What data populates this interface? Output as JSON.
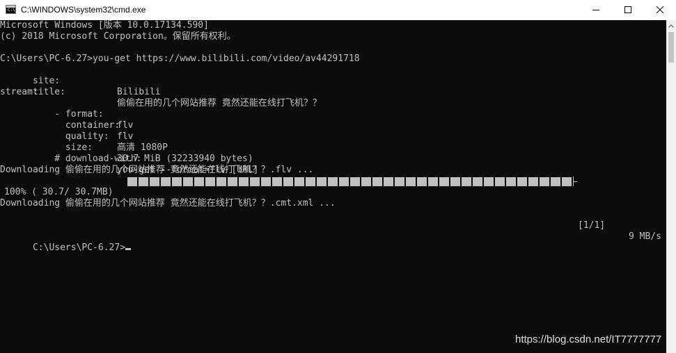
{
  "window": {
    "title": "C:\\WINDOWS\\system32\\cmd.exe",
    "icon": "cmd-icon",
    "icon_glyph": "C:\\_"
  },
  "controls": {
    "minimize_icon": "minimize-icon",
    "maximize_icon": "maximize-icon",
    "close_icon": "close-icon"
  },
  "console": {
    "header1": "Microsoft Windows [版本 10.0.17134.590]",
    "header2": "(c) 2018 Microsoft Corporation。保留所有权利。",
    "command_line": "C:\\Users\\PC-6.27>you-get https://www.bilibili.com/video/av44291718",
    "site_label": "site:",
    "site_value": "Bilibili",
    "title_label": "title:",
    "title_value": "偷偷在用的几个网站推荐 竟然还能在线打飞机？？",
    "stream_label": "stream:",
    "format_label": "    - format:",
    "format_value": "flv",
    "container_label": "      container:",
    "container_value": "flv",
    "quality_label": "      quality:",
    "quality_value": "高清 1080P",
    "size_label": "      size:",
    "size_value": "30.7 MiB (32233940 bytes)",
    "download_with_label": "    # download-with:",
    "download_with_value": "you-get --format=flv [URL]",
    "downloading_flv": "Downloading 偷偷在用的几个网站推荐 竟然还能在线打飞机？？.flv ...",
    "progress_percent_text": "100% ( 30.7/ 30.7MB)",
    "progress_count": "[1/1]",
    "progress_speed": "9 MB/s",
    "downloading_xml": "Downloading 偷偷在用的几个网站推荐 竟然还能在线打飞机？？.cmt.xml ...",
    "prompt": "C:\\Users\\PC-6.27>"
  },
  "progress": {
    "fraction": 1.0
  },
  "colors": {
    "background": "#0c0c0c",
    "foreground": "#c0c0c0",
    "titlebar": "#ffffff"
  },
  "watermark": "https://blog.csdn.net/IT7777777"
}
